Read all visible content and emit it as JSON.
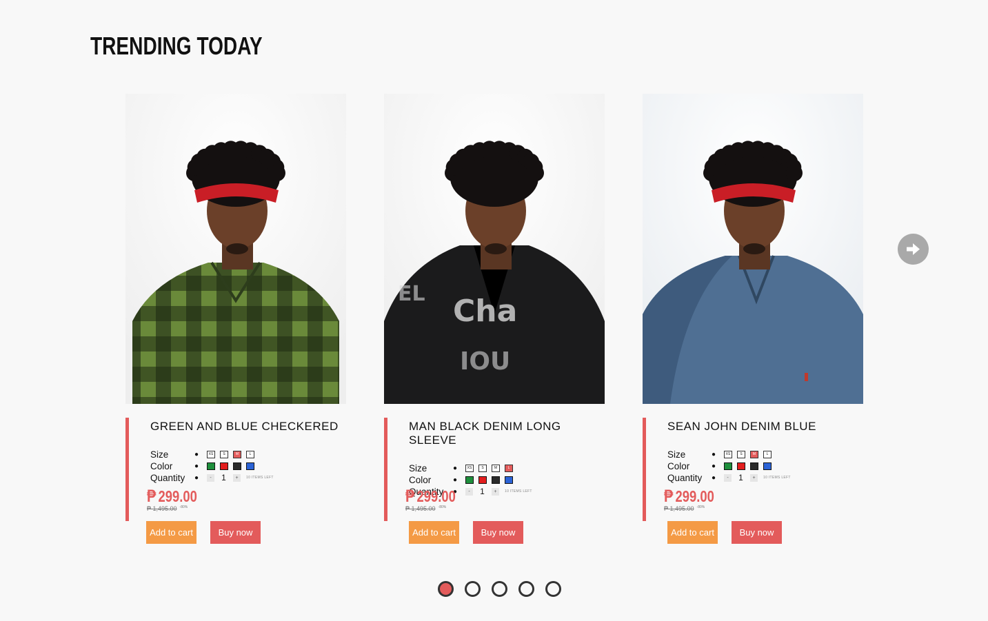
{
  "section": {
    "title": "TRENDING TODAY"
  },
  "products": [
    {
      "name": "GREEN AND BLUE CHECKERED",
      "size_label": "Size",
      "color_label": "Color",
      "quantity_label": "Quantity",
      "sizes": [
        "XS",
        "S",
        "M",
        "L"
      ],
      "selected_size": "M",
      "colors": [
        "#1e8f3c",
        "#e21d1d",
        "#2a2a2a",
        "#2b63d6"
      ],
      "quantity": "1",
      "qty_minus": "-",
      "qty_plus": "+",
      "items_left": "10 ITEMS LEFT",
      "currency": "₱",
      "price": "299.00",
      "old_price": "₱ 1,495.00",
      "discount": "-80%",
      "add_to_cart": "Add to cart",
      "buy_now": "Buy now",
      "shirt": "green-plaid-shirt",
      "bandana": true
    },
    {
      "name": "MAN BLACK DENIM LONG SLEEVE",
      "size_label": "Size",
      "color_label": "Color",
      "quantity_label": "Quantity",
      "sizes": [
        "XS",
        "S",
        "M",
        "L"
      ],
      "selected_size": "L",
      "colors": [
        "#1e8f3c",
        "#e21d1d",
        "#2a2a2a",
        "#2b63d6"
      ],
      "quantity": "1",
      "qty_minus": "-",
      "qty_plus": "+",
      "items_left": "10 ITEMS LEFT",
      "currency": "₱",
      "price": "299.00",
      "old_price": "₱ 1,495.00",
      "discount": "-80%",
      "add_to_cart": "Add to cart",
      "buy_now": "Buy now",
      "shirt": "black-denim-jacket",
      "bandana": false
    },
    {
      "name": "SEAN JOHN DENIM BLUE",
      "size_label": "Size",
      "color_label": "Color",
      "quantity_label": "Quantity",
      "sizes": [
        "XS",
        "S",
        "M",
        "L"
      ],
      "selected_size": "M",
      "colors": [
        "#1e8f3c",
        "#e21d1d",
        "#2a2a2a",
        "#2b63d6"
      ],
      "quantity": "1",
      "qty_minus": "-",
      "qty_plus": "+",
      "items_left": "10 ITEMS LEFT",
      "currency": "₱",
      "price": "299.00",
      "old_price": "₱ 1,495.00",
      "discount": "-80%",
      "add_to_cart": "Add to cart",
      "buy_now": "Buy now",
      "shirt": "blue-denim-shirt",
      "bandana": true
    }
  ],
  "carousel": {
    "next_icon": "arrow-right-icon",
    "page_count": 5,
    "active_page": 1
  },
  "colors": {
    "accent_red": "#e35b5b",
    "cart_orange": "#f49a45"
  }
}
